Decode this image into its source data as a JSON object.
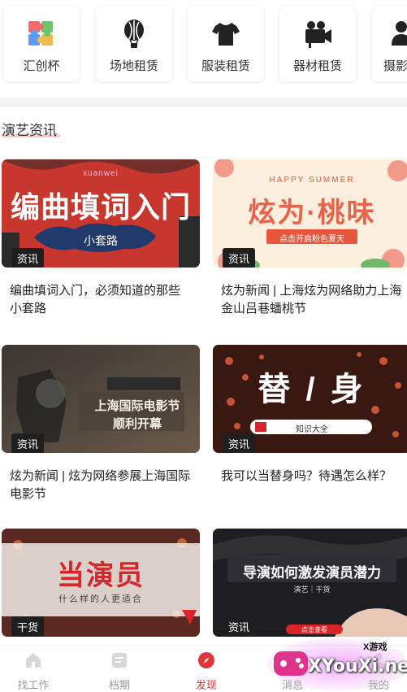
{
  "categories": [
    {
      "label": "汇创杯",
      "icon": "puzzle-icon"
    },
    {
      "label": "场地租赁",
      "icon": "balloon-icon"
    },
    {
      "label": "服装租赁",
      "icon": "shirt-icon"
    },
    {
      "label": "器材租赁",
      "icon": "camera-icon"
    },
    {
      "label": "摄影",
      "icon": "people-icon"
    }
  ],
  "section": {
    "title": "演艺资讯"
  },
  "articles": [
    {
      "tag": "资讯",
      "title": "编曲填词入门，必须知道的那些小套路",
      "thumb": {
        "top_text": "xuanwei",
        "main_text": "编曲填词入门",
        "sub_text": "小套路"
      }
    },
    {
      "tag": "资讯",
      "title": "炫为新闻 | 上海炫为网络助力上海金山吕巷蟠桃节",
      "thumb": {
        "top_text": "HAPPY SUMMER",
        "main_text": "炫为·桃味",
        "sub_text": "点击开启粉色夏天"
      }
    },
    {
      "tag": "资讯",
      "title": "炫为新闻 | 炫为网络参展上海国际电影节",
      "thumb": {
        "main_text": "上海国际电影节",
        "sub_text": "顺利开幕"
      }
    },
    {
      "tag": "资讯",
      "title": "我可以当替身吗？待遇怎么样？",
      "thumb": {
        "main_text": "替 / 身",
        "sub_text": "知识大全"
      }
    },
    {
      "tag": "干货",
      "title": "",
      "thumb": {
        "main_text": "当演员",
        "sub_text": "什么样的人更适合"
      }
    },
    {
      "tag": "资讯",
      "title": "",
      "thumb": {
        "main_text": "导演如何激发演员潜力",
        "sub_text": "演艺｜干货",
        "small_text": "点击查看"
      }
    }
  ],
  "nav": [
    {
      "label": "找工作",
      "icon": "home-icon",
      "active": false
    },
    {
      "label": "档期",
      "icon": "schedule-icon",
      "active": false
    },
    {
      "label": "发现",
      "icon": "compass-icon",
      "active": true
    },
    {
      "label": "消息",
      "icon": "message-icon",
      "active": false
    },
    {
      "label": "我的",
      "icon": "profile-icon",
      "active": false
    }
  ],
  "watermark": {
    "text": "XYouXi.net",
    "sub": "X游戏"
  },
  "colors": {
    "accent": "#e0343b",
    "tag_bg": "#1f1f1f"
  }
}
